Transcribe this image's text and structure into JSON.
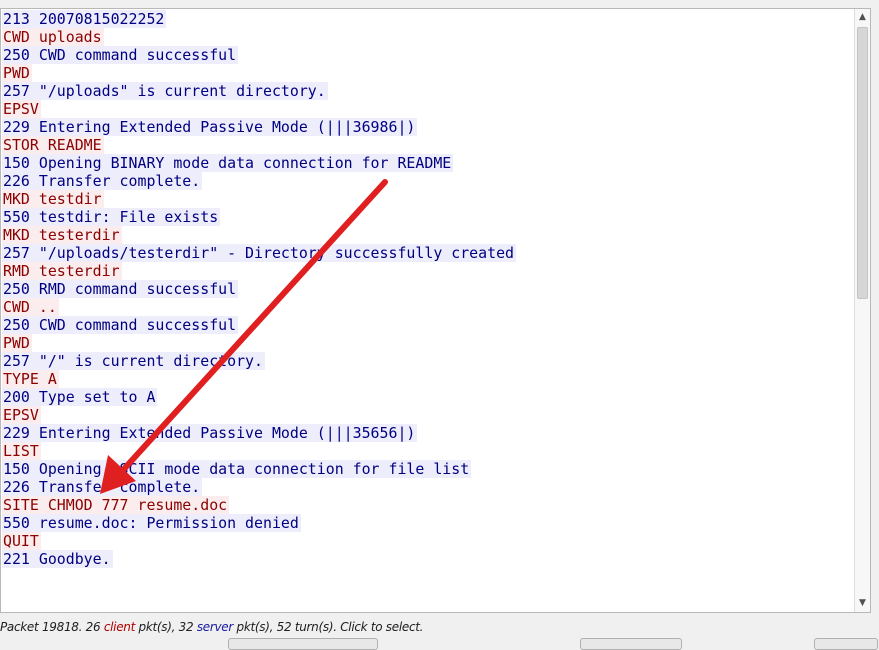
{
  "colors": {
    "client_fg": "#8b0000",
    "client_bg": "#fbeded",
    "server_fg": "#000080",
    "server_bg": "#ededfb",
    "arrow": "#e02020"
  },
  "stream": {
    "lines": [
      {
        "side": "server",
        "text": "213 20070815022252"
      },
      {
        "side": "client",
        "text": "CWD uploads"
      },
      {
        "side": "server",
        "text": "250 CWD command successful"
      },
      {
        "side": "client",
        "text": "PWD"
      },
      {
        "side": "server",
        "text": "257 \"/uploads\" is current directory."
      },
      {
        "side": "client",
        "text": "EPSV"
      },
      {
        "side": "server",
        "text": "229 Entering Extended Passive Mode (|||36986|)"
      },
      {
        "side": "client",
        "text": "STOR README"
      },
      {
        "side": "server",
        "text": "150 Opening BINARY mode data connection for README"
      },
      {
        "side": "server",
        "text": "226 Transfer complete."
      },
      {
        "side": "client",
        "text": "MKD testdir"
      },
      {
        "side": "server",
        "text": "550 testdir: File exists"
      },
      {
        "side": "client",
        "text": "MKD testerdir"
      },
      {
        "side": "server",
        "text": "257 \"/uploads/testerdir\" - Directory successfully created"
      },
      {
        "side": "client",
        "text": "RMD testerdir"
      },
      {
        "side": "server",
        "text": "250 RMD command successful"
      },
      {
        "side": "client",
        "text": "CWD .."
      },
      {
        "side": "server",
        "text": "250 CWD command successful"
      },
      {
        "side": "client",
        "text": "PWD"
      },
      {
        "side": "server",
        "text": "257 \"/\" is current directory."
      },
      {
        "side": "client",
        "text": "TYPE A"
      },
      {
        "side": "server",
        "text": "200 Type set to A"
      },
      {
        "side": "client",
        "text": "EPSV"
      },
      {
        "side": "server",
        "text": "229 Entering Extended Passive Mode (|||35656|)"
      },
      {
        "side": "client",
        "text": "LIST"
      },
      {
        "side": "server",
        "text": "150 Opening ASCII mode data connection for file list"
      },
      {
        "side": "server",
        "text": "226 Transfer complete."
      },
      {
        "side": "client",
        "text": "SITE CHMOD 777 resume.doc"
      },
      {
        "side": "server",
        "text": "550 resume.doc: Permission denied"
      },
      {
        "side": "client",
        "text": "QUIT"
      },
      {
        "side": "server",
        "text": "221 Goodbye."
      }
    ]
  },
  "scrollbar": {
    "up_icon": "▲",
    "down_icon": "▼",
    "thumb_fraction": 0.45
  },
  "status": {
    "prefix": "Packet 19818. 26 ",
    "client_word": "client",
    "mid1": " pkt(s), 32 ",
    "server_word": "server",
    "suffix": " pkt(s), 52 turn(s). Click to select."
  }
}
